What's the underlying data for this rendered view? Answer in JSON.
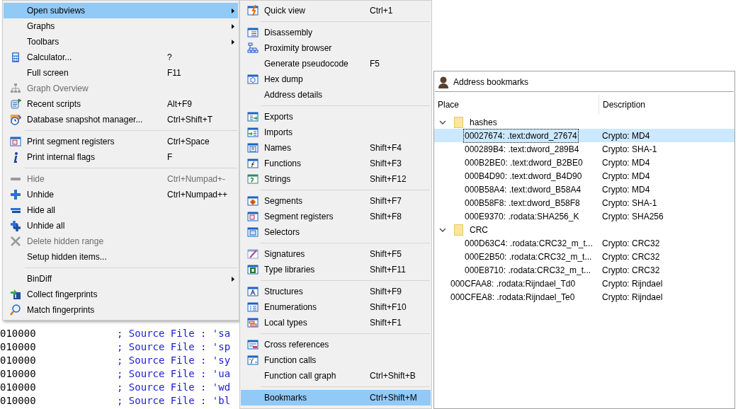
{
  "disassembly": {
    "lines": [
      {
        "address": "010000",
        "comment": "; Source File : 'sa"
      },
      {
        "address": "010000",
        "comment": "; Source File : 'sp"
      },
      {
        "address": "010000",
        "comment": "; Source File : 'sy"
      },
      {
        "address": "010000",
        "comment": "; Source File : 'ua"
      },
      {
        "address": "010000",
        "comment": "; Source File : 'wd"
      },
      {
        "address": "010000",
        "comment": "; Source File : 'bl"
      }
    ]
  },
  "view_menu": {
    "items": [
      {
        "kind": "item",
        "label": "Open subviews",
        "submenu": true,
        "disabled": false,
        "selected": true
      },
      {
        "kind": "item",
        "label": "Graphs",
        "submenu": true,
        "disabled": false,
        "selected": false
      },
      {
        "kind": "item",
        "label": "Toolbars",
        "submenu": true,
        "disabled": false,
        "selected": false
      },
      {
        "kind": "item",
        "label": "Calculator...",
        "shortcut": "?",
        "submenu": false,
        "disabled": false,
        "selected": false
      },
      {
        "kind": "item",
        "label": "Full screen",
        "shortcut": "F11",
        "submenu": false,
        "disabled": false,
        "selected": false
      },
      {
        "kind": "item",
        "label": "Graph Overview",
        "submenu": false,
        "disabled": true,
        "selected": false
      },
      {
        "kind": "item",
        "label": "Recent scripts",
        "shortcut": "Alt+F9",
        "submenu": false,
        "disabled": false,
        "selected": false
      },
      {
        "kind": "item",
        "label": "Database snapshot manager...",
        "shortcut": "Ctrl+Shift+T",
        "submenu": false,
        "disabled": false,
        "selected": false
      },
      {
        "kind": "separator"
      },
      {
        "kind": "item",
        "label": "Print segment registers",
        "shortcut": "Ctrl+Space",
        "submenu": false,
        "disabled": false,
        "selected": false
      },
      {
        "kind": "item",
        "label": "Print internal flags",
        "shortcut": "F",
        "submenu": false,
        "disabled": false,
        "selected": false
      },
      {
        "kind": "separator"
      },
      {
        "kind": "item",
        "label": "Hide",
        "shortcut": "Ctrl+Numpad+-",
        "submenu": false,
        "disabled": true,
        "selected": false
      },
      {
        "kind": "item",
        "label": "Unhide",
        "shortcut": "Ctrl+Numpad++",
        "submenu": false,
        "disabled": false,
        "selected": false
      },
      {
        "kind": "item",
        "label": "Hide all",
        "submenu": false,
        "disabled": false,
        "selected": false
      },
      {
        "kind": "item",
        "label": "Unhide all",
        "submenu": false,
        "disabled": false,
        "selected": false
      },
      {
        "kind": "item",
        "label": "Delete hidden range",
        "submenu": false,
        "disabled": true,
        "selected": false
      },
      {
        "kind": "item",
        "label": "Setup hidden items...",
        "submenu": false,
        "disabled": false,
        "selected": false
      },
      {
        "kind": "separator"
      },
      {
        "kind": "item",
        "label": "BinDiff",
        "submenu": true,
        "disabled": false,
        "selected": false
      },
      {
        "kind": "item",
        "label": "Collect fingerprints",
        "submenu": false,
        "disabled": false,
        "selected": false
      },
      {
        "kind": "item",
        "label": "Match fingerprints",
        "submenu": false,
        "disabled": false,
        "selected": false
      }
    ]
  },
  "subviews_menu": {
    "items": [
      {
        "kind": "item",
        "label": "Quick view",
        "shortcut": "Ctrl+1",
        "selected": false
      },
      {
        "kind": "separator"
      },
      {
        "kind": "item",
        "label": "Disassembly",
        "selected": false
      },
      {
        "kind": "item",
        "label": "Proximity browser",
        "selected": false
      },
      {
        "kind": "item",
        "label": "Generate pseudocode",
        "shortcut": "F5",
        "selected": false
      },
      {
        "kind": "item",
        "label": "Hex dump",
        "selected": false
      },
      {
        "kind": "item",
        "label": "Address details",
        "selected": false
      },
      {
        "kind": "separator"
      },
      {
        "kind": "item",
        "label": "Exports",
        "selected": false
      },
      {
        "kind": "item",
        "label": "Imports",
        "selected": false
      },
      {
        "kind": "item",
        "label": "Names",
        "shortcut": "Shift+F4",
        "selected": false
      },
      {
        "kind": "item",
        "label": "Functions",
        "shortcut": "Shift+F3",
        "selected": false
      },
      {
        "kind": "item",
        "label": "Strings",
        "shortcut": "Shift+F12",
        "selected": false
      },
      {
        "kind": "separator"
      },
      {
        "kind": "item",
        "label": "Segments",
        "shortcut": "Shift+F7",
        "selected": false
      },
      {
        "kind": "item",
        "label": "Segment registers",
        "shortcut": "Shift+F8",
        "selected": false
      },
      {
        "kind": "item",
        "label": "Selectors",
        "selected": false
      },
      {
        "kind": "separator"
      },
      {
        "kind": "item",
        "label": "Signatures",
        "shortcut": "Shift+F5",
        "selected": false
      },
      {
        "kind": "item",
        "label": "Type libraries",
        "shortcut": "Shift+F11",
        "selected": false
      },
      {
        "kind": "separator"
      },
      {
        "kind": "item",
        "label": "Structures",
        "shortcut": "Shift+F9",
        "selected": false
      },
      {
        "kind": "item",
        "label": "Enumerations",
        "shortcut": "Shift+F10",
        "selected": false
      },
      {
        "kind": "item",
        "label": "Local types",
        "shortcut": "Shift+F1",
        "selected": false
      },
      {
        "kind": "separator"
      },
      {
        "kind": "item",
        "label": "Cross references",
        "selected": false
      },
      {
        "kind": "item",
        "label": "Function calls",
        "selected": false
      },
      {
        "kind": "item",
        "label": "Function call graph",
        "shortcut": "Ctrl+Shift+B",
        "selected": false
      },
      {
        "kind": "separator"
      },
      {
        "kind": "item",
        "label": "Bookmarks",
        "shortcut": "Ctrl+Shift+M",
        "selected": true
      }
    ]
  },
  "bookmarks_panel": {
    "title": "Address bookmarks",
    "columns": [
      "Place",
      "Description"
    ],
    "rows": [
      {
        "kind": "folder",
        "place": "hashes",
        "expanded": true,
        "children": [
          {
            "kind": "bookmark",
            "place": "00027674: .text:dword_27674",
            "description": "Crypto: MD4",
            "selected": true
          },
          {
            "kind": "bookmark",
            "place": "000289B4: .text:dword_289B4",
            "description": "Crypto: SHA-1",
            "selected": false
          },
          {
            "kind": "bookmark",
            "place": "000B2BE0: .text:dword_B2BE0",
            "description": "Crypto: MD4",
            "selected": false
          },
          {
            "kind": "bookmark",
            "place": "000B4D90: .text:dword_B4D90",
            "description": "Crypto: MD4",
            "selected": false
          },
          {
            "kind": "bookmark",
            "place": "000B58A4: .text:dword_B58A4",
            "description": "Crypto: MD4",
            "selected": false
          },
          {
            "kind": "bookmark",
            "place": "000B58F8: .text:dword_B58F8",
            "description": "Crypto: SHA-1",
            "selected": false
          },
          {
            "kind": "bookmark",
            "place": "000E9370: .rodata:SHA256_K",
            "description": "Crypto: SHA256",
            "selected": false
          }
        ]
      },
      {
        "kind": "folder",
        "place": "CRC",
        "expanded": true,
        "children": [
          {
            "kind": "bookmark",
            "place": "000D63C4: .rodata:CRC32_m_t...",
            "description": "Crypto: CRC32",
            "selected": false
          },
          {
            "kind": "bookmark",
            "place": "000E2B50: .rodata:CRC32_m_t...",
            "description": "Crypto: CRC32",
            "selected": false
          },
          {
            "kind": "bookmark",
            "place": "000E8710: .rodata:CRC32_m_t...",
            "description": "Crypto: CRC32",
            "selected": false
          }
        ]
      },
      {
        "kind": "bookmark",
        "place": "000CFAA8: .rodata:Rijndael_Td0",
        "description": "Crypto: Rijndael",
        "selected": false
      },
      {
        "kind": "bookmark",
        "place": "000CFEA8: .rodata:Rijndael_Te0",
        "description": "Crypto: Rijndael",
        "selected": false
      }
    ]
  }
}
